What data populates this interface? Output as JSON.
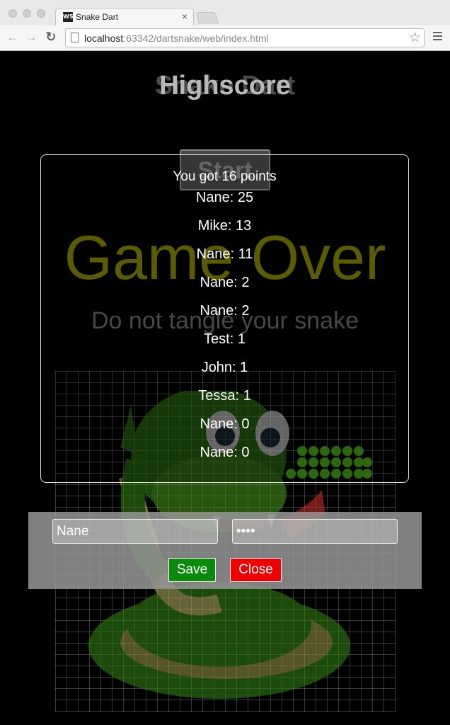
{
  "browser": {
    "tab_title": "Snake Dart",
    "tab_icon_text": "WS",
    "close_glyph": "×",
    "url_host": "localhost",
    "url_rest": ":63342/dartsnake/web/index.html",
    "back_icon": "←",
    "forward_icon": "→",
    "reload_icon": "↻",
    "star_icon": "☆"
  },
  "game": {
    "title_behind": "Snake Dart",
    "title_overlay": "Highscore",
    "start_label": "Start",
    "game_over_text": "Game Over",
    "tip_text": "Do not tangle your snake"
  },
  "highscore": {
    "header": "You got 16 points",
    "entries": [
      {
        "text": "Nane: 25"
      },
      {
        "text": "Mike: 13"
      },
      {
        "text": "Nane: 11"
      },
      {
        "text": "Nane: 2"
      },
      {
        "text": "Nane: 2"
      },
      {
        "text": "Test: 1"
      },
      {
        "text": "John: 1"
      },
      {
        "text": "Tessa: 1"
      },
      {
        "text": "Nane: 0"
      },
      {
        "text": "Nane: 0"
      }
    ]
  },
  "save_form": {
    "name_value": "Nane",
    "password_value": "••••",
    "save_label": "Save",
    "close_label": "Close"
  },
  "colors": {
    "save_button": "#0a8a0a",
    "close_button": "#ee0000",
    "game_over": "#7a7a00",
    "snake_body": "#3a8a10"
  }
}
